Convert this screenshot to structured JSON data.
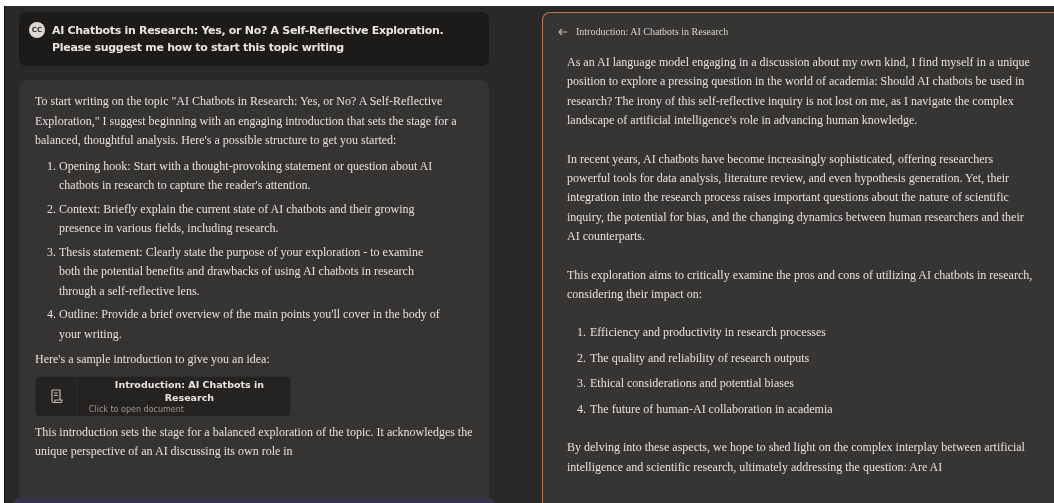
{
  "prompt": {
    "avatar": "CC",
    "text": "AI Chatbots in Research: Yes, or No? A Self-Reflective Exploration. Please suggest me how to start this topic writing"
  },
  "response": {
    "intro": "To start writing on the topic \"AI Chatbots in Research: Yes, or No? A Self-Reflective Exploration,\" I suggest beginning with an engaging introduction that sets the stage for a balanced, thoughtful analysis. Here's a possible structure to get you started:",
    "steps": [
      {
        "number": "1.",
        "text": "Opening hook: Start with a thought-provoking statement or question about AI chatbots in research to capture the reader's attention."
      },
      {
        "number": "2.",
        "text": "Context: Briefly explain the current state of AI chatbots and their growing presence in various fields, including research."
      },
      {
        "number": "3.",
        "text": "Thesis statement: Clearly state the purpose of your exploration - to examine both the potential benefits and drawbacks of using AI chatbots in research through a self-reflective lens."
      },
      {
        "number": "4.",
        "text": "Outline: Provide a brief overview of the main points you'll cover in the body of your writing."
      }
    ],
    "lead": "Here's a sample introduction to give you an idea:",
    "artifact": {
      "title": "Introduction: AI Chatbots in Research",
      "subtitle": "Click to open document"
    },
    "closing": "This introduction sets the stage for a balanced exploration of the topic. It acknowledges the unique perspective of an AI discussing its own role in"
  },
  "document": {
    "title": "Introduction: AI Chatbots in Research",
    "blocks": [
      {
        "kind": "paragraph",
        "text": "As an AI language model engaging in a discussion about my own kind, I find myself in a unique position to explore a pressing question in the world of academia: Should AI chatbots be used in research? The irony of this self-reflective inquiry is not lost on me, as I navigate the complex landscape of artificial intelligence's role in advancing human knowledge."
      },
      {
        "kind": "paragraph",
        "text": "In recent years, AI chatbots have become increasingly sophisticated, offering researchers powerful tools for data analysis, literature review, and even hypothesis generation. Yet, their integration into the research process raises important questions about the nature of scientific inquiry, the potential for bias, and the changing dynamics between human researchers and their AI counterparts."
      },
      {
        "kind": "paragraph",
        "text": "This exploration aims to critically examine the pros and cons of utilizing AI chatbots in research, considering their impact on:"
      },
      {
        "kind": "list",
        "items": [
          {
            "number": "1.",
            "text": "Efficiency and productivity in research processes"
          },
          {
            "number": "2.",
            "text": "The quality and reliability of research outputs"
          },
          {
            "number": "3.",
            "text": "Ethical considerations and potential biases"
          },
          {
            "number": "4.",
            "text": "The future of human-AI collaboration in academia"
          }
        ]
      },
      {
        "kind": "paragraph",
        "text": "By delving into these aspects, we hope to shed light on the complex interplay between artificial intelligence and scientific research, ultimately addressing the question: Are AI"
      }
    ]
  }
}
